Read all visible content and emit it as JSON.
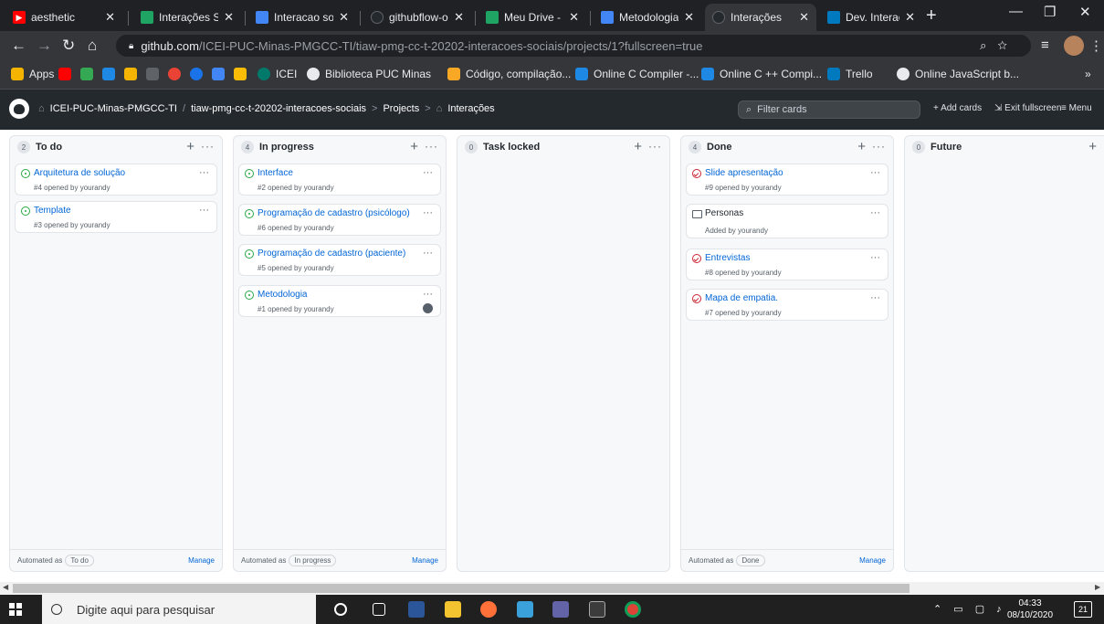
{
  "browser": {
    "tabs": [
      {
        "label": "aesthetic",
        "color": "#ff0000",
        "active": false
      },
      {
        "label": "Interações Soc",
        "color": "#1fa463",
        "active": false
      },
      {
        "label": "Interacao soci",
        "color": "#4285f4",
        "active": false
      },
      {
        "label": "githubflow-on",
        "color": "#24292e",
        "active": false
      },
      {
        "label": "Meu Drive - G",
        "color": "#1fa463",
        "active": false
      },
      {
        "label": "Metodologia.",
        "color": "#4285f4",
        "active": false
      },
      {
        "label": "Interações",
        "color": "#24292e",
        "active": true
      },
      {
        "label": "Dev. Interação",
        "color": "#0079bf",
        "active": false
      }
    ],
    "url_host": "github.com",
    "url_path": "/ICEI-PUC-Minas-PMGCC-TI/tiaw-pmg-cc-t-20202-interacoes-sociais/projects/1?fullscreen=true",
    "bookmarks": [
      {
        "label": "Apps",
        "color": "#f4b400"
      },
      {
        "label": "",
        "color": "#ff0000"
      },
      {
        "label": "",
        "color": "#34a853"
      },
      {
        "label": "",
        "color": "#1e88e5"
      },
      {
        "label": "",
        "color": "#f4b400"
      },
      {
        "label": "",
        "color": "#5f6368"
      },
      {
        "label": "",
        "color": "#ea4335"
      },
      {
        "label": "",
        "color": "#1a73e8"
      },
      {
        "label": "",
        "color": "#4285f4"
      },
      {
        "label": "",
        "color": "#fbbc05"
      },
      {
        "label": "ICEI",
        "color": "#00796b"
      },
      {
        "label": "Biblioteca PUC Minas",
        "color": "#e8eaed"
      },
      {
        "label": "Código, compilação...",
        "color": "#f9a825"
      },
      {
        "label": "Online C Compiler -...",
        "color": "#1e88e5"
      },
      {
        "label": "Online C ++ Compi...",
        "color": "#1e88e5"
      },
      {
        "label": "Trello",
        "color": "#0079bf"
      },
      {
        "label": "Online JavaScript b...",
        "color": "#e8eaed"
      }
    ],
    "bookmarks_more": "»"
  },
  "github": {
    "breadcrumb": {
      "org": "ICEI-PUC-Minas-PMGCC-TI",
      "slash": "/",
      "repo": "tiaw-pmg-cc-t-20202-interacoes-sociais",
      "sep1": ">",
      "projects": "Projects",
      "sep2": ">",
      "project": "Interações"
    },
    "filter_placeholder": "Filter cards",
    "add_cards": "+ Add cards",
    "exit_fullscreen": "Exit fullscreen",
    "menu": "Menu"
  },
  "board": {
    "columns": [
      {
        "name": "To do",
        "count": "2",
        "cards": [
          {
            "title": "Arquitetura de solução",
            "meta": "#4 opened by yourandy",
            "icon": "issue-open-icon"
          },
          {
            "title": "Template",
            "meta": "#3 opened by yourandy",
            "icon": "issue-open-icon"
          }
        ],
        "automated_label": "Automated as",
        "automated_value": "To do",
        "manage": "Manage"
      },
      {
        "name": "In progress",
        "count": "4",
        "cards": [
          {
            "title": "Interface",
            "meta": "#2 opened by yourandy",
            "icon": "issue-open-icon"
          },
          {
            "title": "Programação de cadastro (psicólogo)",
            "meta": "#6 opened by yourandy",
            "icon": "issue-open-icon"
          },
          {
            "title": "Programação de cadastro (paciente)",
            "meta": "#5 opened by yourandy",
            "icon": "issue-open-icon"
          },
          {
            "title": "Metodologia",
            "meta": "#1 opened by yourandy",
            "icon": "issue-open-icon"
          }
        ],
        "automated_label": "Automated as",
        "automated_value": "In progress",
        "manage": "Manage"
      },
      {
        "name": "Task locked",
        "count": "0",
        "cards": []
      },
      {
        "name": "Done",
        "count": "4",
        "cards": [
          {
            "title": "Slide apresentação",
            "meta": "#9 opened by yourandy",
            "icon": "issue-closed-icon"
          },
          {
            "title": "Personas",
            "meta": "Added by yourandy",
            "icon": "note-icon"
          },
          {
            "title": "Entrevistas",
            "meta": "#8 opened by yourandy",
            "icon": "issue-closed-icon"
          },
          {
            "title": "Mapa de empatia.",
            "meta": "#7 opened by yourandy",
            "icon": "issue-closed-icon"
          }
        ],
        "automated_label": "Automated as",
        "automated_value": "Done",
        "manage": "Manage"
      },
      {
        "name": "Future",
        "count": "0",
        "cards": []
      }
    ]
  },
  "taskbar": {
    "search_placeholder": "Digite aqui para pesquisar",
    "time": "04:33",
    "date": "08/10/2020",
    "notifications": "21"
  }
}
